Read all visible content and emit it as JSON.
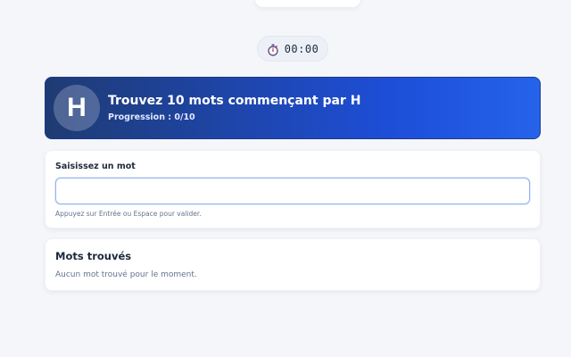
{
  "timer": {
    "icon": "stopwatch-icon",
    "value": "00:00"
  },
  "challenge": {
    "letter": "H",
    "title": "Trouvez 10 mots commençant par H",
    "progress_text": "Progression : 0/10",
    "progress": {
      "found": 0,
      "total": 10
    }
  },
  "input_card": {
    "label": "Saisissez un mot",
    "value": "",
    "hint": "Appuyez sur Entrée ou Espace pour valider."
  },
  "found_words": {
    "title": "Mots trouvés",
    "items": [],
    "empty_message": "Aucun mot trouvé pour le moment."
  },
  "colors": {
    "banner_start": "#1f3b73",
    "banner_end": "#2563eb",
    "input_border": "#93b4e8",
    "page_background": "#f4f6fa"
  }
}
